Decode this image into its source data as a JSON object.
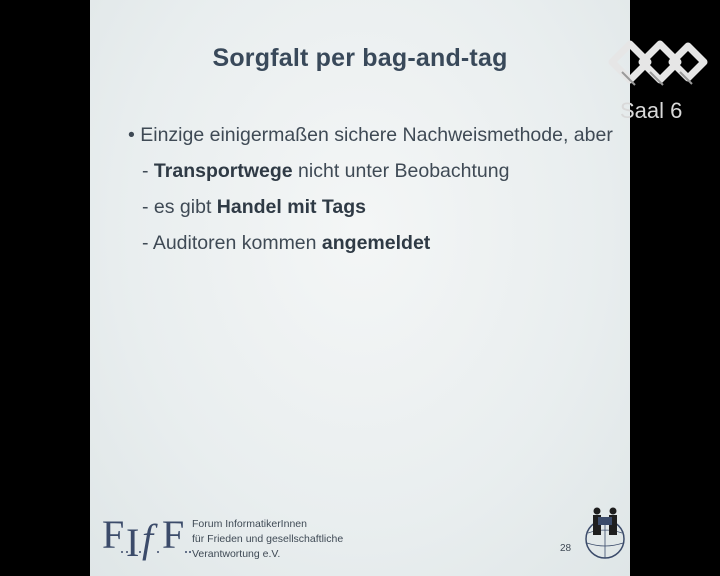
{
  "slide": {
    "title": "Sorgfalt per bag-and-tag",
    "bullets": {
      "main": "• Einzige einigermaßen sichere Nachweismethode, aber",
      "sub1": {
        "prefix": "- ",
        "bold": "Transportwege",
        "rest": " nicht unter Beobachtung"
      },
      "sub2": {
        "prefix": "- es gibt ",
        "bold": "Handel mit Tags",
        "rest": ""
      },
      "sub3": {
        "prefix": "- Auditoren kommen ",
        "bold": "angemeldet",
        "rest": ""
      }
    },
    "footer": {
      "org_line1": "Forum InformatikerInnen",
      "org_line2": "für Frieden und gesellschaftliche",
      "org_line3": "Verantwortung e.V.",
      "page_number": "28"
    }
  },
  "overlay": {
    "channel_label": "Saal 6"
  }
}
